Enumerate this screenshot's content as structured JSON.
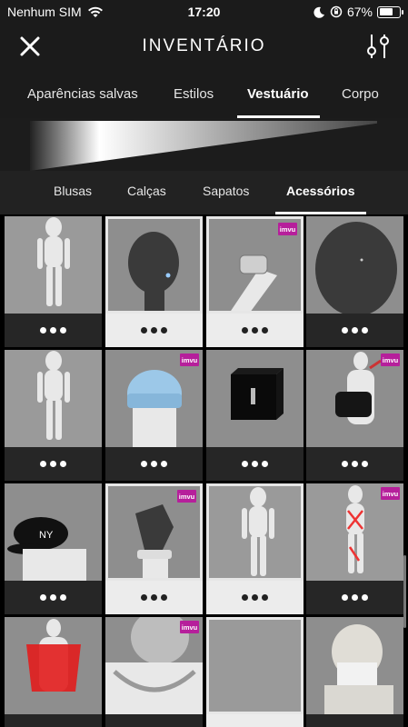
{
  "status_bar": {
    "carrier": "Nenhum SIM",
    "time": "17:20",
    "battery_percent": "67%",
    "battery_level": 0.67
  },
  "header": {
    "title": "INVENTÁRIO",
    "close_icon": "close-icon",
    "filter_icon": "sliders-icon"
  },
  "main_tabs": [
    {
      "label": "Aparências salvas",
      "active": false
    },
    {
      "label": "Estilos",
      "active": false
    },
    {
      "label": "Vestuário",
      "active": true
    },
    {
      "label": "Corpo",
      "active": false
    }
  ],
  "sub_tabs": [
    {
      "label": "Blusas",
      "active": false
    },
    {
      "label": "Calças",
      "active": false
    },
    {
      "label": "Sapatos",
      "active": false
    },
    {
      "label": "Acessórios",
      "active": true
    }
  ],
  "items": [
    {
      "thumb": "avatar-body",
      "badge": "",
      "selected": false
    },
    {
      "thumb": "head-earring",
      "badge": "",
      "selected": true
    },
    {
      "thumb": "wrist-watch",
      "badge": "imvu",
      "selected": true
    },
    {
      "thumb": "head-earring-close",
      "badge": "",
      "selected": false
    },
    {
      "thumb": "avatar-body",
      "badge": "",
      "selected": false
    },
    {
      "thumb": "blue-beanie",
      "badge": "imvu",
      "selected": false
    },
    {
      "thumb": "black-cube",
      "badge": "",
      "selected": false
    },
    {
      "thumb": "black-backpack",
      "badge": "imvu",
      "selected": false
    },
    {
      "thumb": "ny-cap",
      "badge": "",
      "selected": false
    },
    {
      "thumb": "hand-bracelet",
      "badge": "imvu",
      "selected": true
    },
    {
      "thumb": "avatar-body",
      "badge": "",
      "selected": true
    },
    {
      "thumb": "red-harness",
      "badge": "imvu",
      "selected": false
    },
    {
      "thumb": "red-vest",
      "badge": "",
      "selected": false
    },
    {
      "thumb": "chain-necklace",
      "badge": "imvu",
      "selected": false
    },
    {
      "thumb": "empty",
      "badge": "",
      "selected": true
    },
    {
      "thumb": "white-balaclava",
      "badge": "",
      "selected": false
    }
  ],
  "more_icon": "more-dots-icon",
  "colors": {
    "header_bg": "#1b1b1b",
    "tile_bg": "#9a9a9a",
    "badge": "#b61f9b"
  }
}
